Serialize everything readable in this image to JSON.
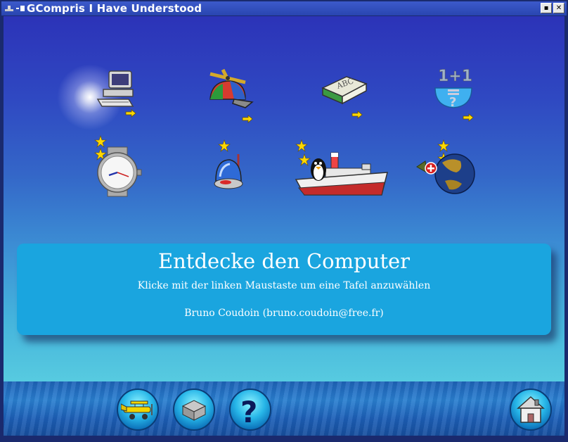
{
  "window": {
    "title": "GCompris I Have Understood",
    "minimize_glyph": "▪",
    "close_glyph": "✕"
  },
  "activities": [
    {
      "icon": "computer-icon",
      "stars": 0,
      "has_submenu": true
    },
    {
      "icon": "propeller-cap-icon",
      "stars": 0,
      "has_submenu": true
    },
    {
      "icon": "abc-book-icon",
      "stars": 0,
      "has_submenu": true
    },
    {
      "icon": "math-bowl-icon",
      "stars": 0,
      "has_submenu": true
    },
    {
      "icon": "watch-icon",
      "stars": 2,
      "has_submenu": false
    },
    {
      "icon": "bulb-ship-icon",
      "stars": 1,
      "has_submenu": false
    },
    {
      "icon": "tux-ship-icon",
      "stars": 2,
      "has_submenu": false
    },
    {
      "icon": "globe-icon",
      "stars": 2,
      "has_submenu": false
    }
  ],
  "info_panel": {
    "title": "Entdecke den Computer",
    "subtitle": "Klicke mit der linken Maustaste um eine Tafel anzuwählen",
    "author": "Bruno Coudoin (bruno.coudoin@free.fr)"
  },
  "bottom_bar": {
    "buttons": [
      {
        "icon": "airplane-icon"
      },
      {
        "icon": "config-box-icon"
      },
      {
        "icon": "help-question-icon"
      },
      {
        "icon": "home-icon"
      }
    ]
  },
  "colors": {
    "title_bar": "#2e4bb8",
    "panel": "#1aa5df",
    "panel_text": "#ffffff",
    "star": "#ffd800"
  }
}
